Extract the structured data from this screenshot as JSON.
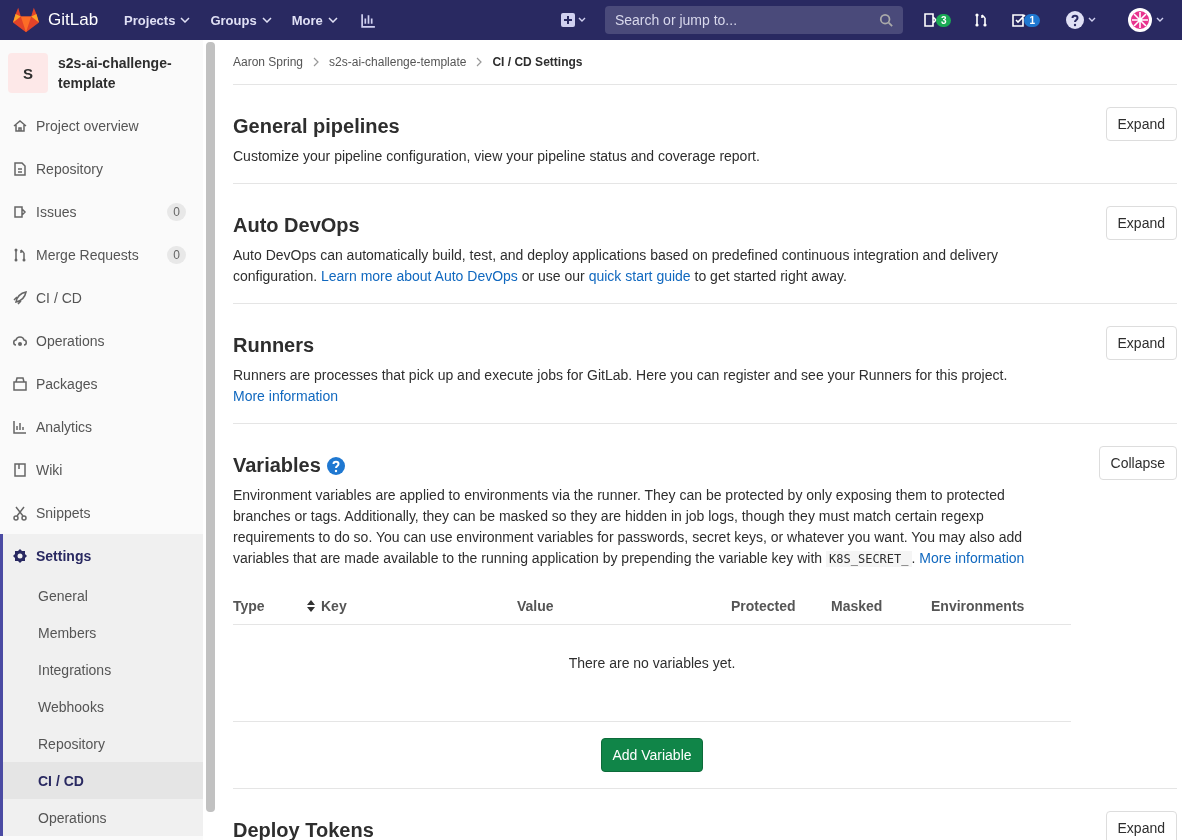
{
  "navbar": {
    "brand": "GitLab",
    "menus": [
      {
        "label": "Projects"
      },
      {
        "label": "Groups"
      },
      {
        "label": "More"
      }
    ],
    "search": {
      "placeholder": "Search or jump to..."
    },
    "issues_count": "3",
    "todos_count": "1"
  },
  "sidebar": {
    "project": {
      "initial": "S",
      "name": "s2s-ai-challenge-template"
    },
    "items": [
      {
        "label": "Project overview",
        "selected": false
      },
      {
        "label": "Repository",
        "selected": false
      },
      {
        "label": "Issues",
        "count": "0",
        "selected": false
      },
      {
        "label": "Merge Requests",
        "count": "0",
        "selected": false
      },
      {
        "label": "CI / CD",
        "selected": false
      },
      {
        "label": "Operations",
        "selected": false
      },
      {
        "label": "Packages",
        "selected": false
      },
      {
        "label": "Analytics",
        "selected": false
      },
      {
        "label": "Wiki",
        "selected": false
      },
      {
        "label": "Snippets",
        "selected": false
      },
      {
        "label": "Settings",
        "selected": true,
        "expanded": true,
        "children": [
          {
            "label": "General",
            "selected": false
          },
          {
            "label": "Members",
            "selected": false
          },
          {
            "label": "Integrations",
            "selected": false
          },
          {
            "label": "Webhooks",
            "selected": false
          },
          {
            "label": "Repository",
            "selected": false
          },
          {
            "label": "CI / CD",
            "selected": true
          },
          {
            "label": "Operations",
            "selected": false
          }
        ]
      }
    ]
  },
  "breadcrumbs": [
    {
      "label": "Aaron Spring",
      "current": false
    },
    {
      "label": "s2s-ai-challenge-template",
      "current": false
    },
    {
      "label": "CI / CD Settings",
      "current": true
    }
  ],
  "sections": [
    {
      "title": "General pipelines",
      "button": "Expand",
      "help": false,
      "parts": [
        {
          "kind": "text",
          "text": "Customize your pipeline configuration, view your pipeline status and coverage report."
        }
      ]
    },
    {
      "title": "Auto DevOps",
      "button": "Expand",
      "help": false,
      "parts": [
        {
          "kind": "text",
          "text": "Auto DevOps can automatically build, test, and deploy applications based on predefined continuous integration and delivery configuration. "
        },
        {
          "kind": "link",
          "text": "Learn more about Auto DevOps"
        },
        {
          "kind": "text",
          "text": " or use our "
        },
        {
          "kind": "link",
          "text": "quick start guide"
        },
        {
          "kind": "text",
          "text": " to get started right away."
        }
      ]
    },
    {
      "title": "Runners",
      "button": "Expand",
      "help": false,
      "parts": [
        {
          "kind": "text",
          "text": "Runners are processes that pick up and execute jobs for GitLab. Here you can register and see your Runners for this project. "
        },
        {
          "kind": "link",
          "text": "More information"
        }
      ]
    },
    {
      "title": "Variables",
      "button": "Collapse",
      "help": true,
      "parts": [
        {
          "kind": "text",
          "text": "Environment variables are applied to environments via the runner. They can be protected by only exposing them to protected branches or tags. Additionally, they can be masked so they are hidden in job logs, though they must match certain regexp requirements to do so. You can use environment variables for passwords, secret keys, or whatever you want. You may also add variables that are made available to the running application by prepending the variable key with "
        },
        {
          "kind": "code",
          "text": "K8S_SECRET_"
        },
        {
          "kind": "text",
          "text": ". "
        },
        {
          "kind": "link",
          "text": "More information"
        }
      ],
      "table": {
        "columns": [
          {
            "label": "Type",
            "sortable": false
          },
          {
            "label": "Key",
            "sortable": true
          },
          {
            "label": "Value",
            "sortable": false
          },
          {
            "label": "Protected",
            "sortable": false
          },
          {
            "label": "Masked",
            "sortable": false
          },
          {
            "label": "Environments",
            "sortable": false
          }
        ],
        "empty": "There are no variables yet.",
        "add_button": "Add Variable"
      }
    },
    {
      "title": "Deploy Tokens",
      "button": "Expand",
      "help": false
    }
  ]
}
